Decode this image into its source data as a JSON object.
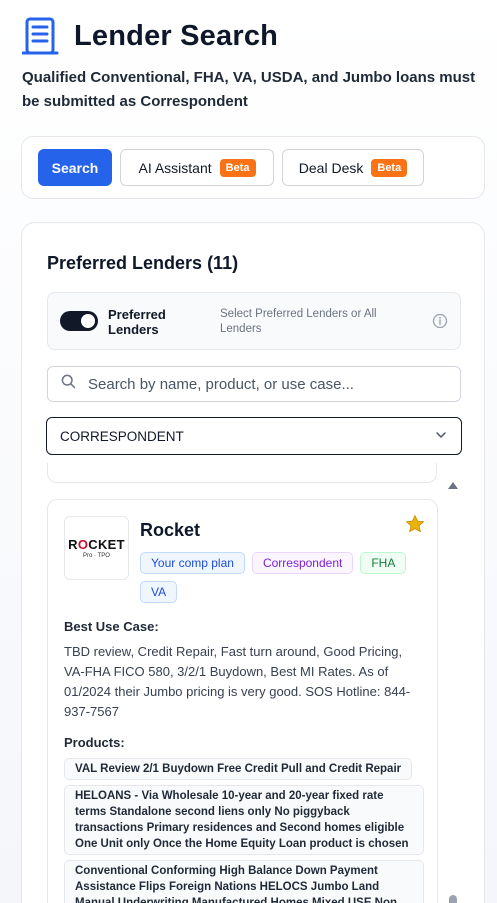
{
  "header": {
    "title": "Lender Search",
    "subtitle": "Qualified Conventional, FHA, VA, USDA, and Jumbo loans must be submitted as Correspondent"
  },
  "modes": {
    "search_label": "Search",
    "ai_label": "AI Assistant",
    "deal_label": "Deal Desk",
    "beta_label": "Beta"
  },
  "colors": {
    "primary": "#2563eb",
    "beta": "#f97316",
    "star": "#eab308"
  },
  "lenders_section": {
    "title": "Preferred Lenders (11)",
    "toggle_label": "Preferred Lenders",
    "toggle_on": true,
    "toggle_help": "Select Preferred Lenders or All Lenders",
    "search_placeholder": "Search by name, product, or use case...",
    "search_value": "",
    "channel_selected": "CORRESPONDENT"
  },
  "lender": {
    "name": "Rocket",
    "logo_text_a": "R",
    "logo_text_b": "O",
    "logo_text_c": "CKET",
    "logo_sub": "Pro · TPO",
    "starred": true,
    "tags": [
      "Your comp plan",
      "Correspondent",
      "FHA",
      "VA"
    ],
    "best_use_label": "Best Use Case:",
    "best_use_text": "TBD review, Credit Repair, Fast turn around, Good Pricing, VA-FHA FICO 580, 3/2/1 Buydown, Best MI Rates. As of 01/2024 their Jumbo pricing is very good. SOS Hotline: 844-937-7567",
    "products_label": "Products:",
    "products": [
      "VAL Review 2/1 Buydown Free Credit Pull and Credit Repair",
      "HELOANS - Via Wholesale 10-year and 20-year fixed rate terms Standalone second liens only No piggyback transactions Primary residences and Second homes eligible One Unit only Once the Home Equity Loan product is chosen",
      "Conventional Conforming High Balance Down Payment Assistance Flips Foreign Nations HELOCS Jumbo Land Manual Underwriting Manufactured Homes Mixed USE Non"
    ]
  }
}
